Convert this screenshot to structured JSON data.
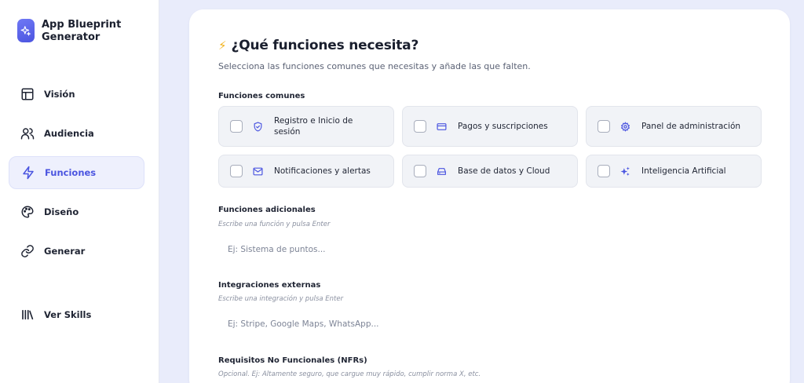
{
  "brand": {
    "title": "App Blueprint Generator"
  },
  "sidebar": {
    "items": [
      {
        "label": "Visión",
        "icon": "layout-icon"
      },
      {
        "label": "Audiencia",
        "icon": "users-icon"
      },
      {
        "label": "Funciones",
        "icon": "bolt-icon",
        "active": true
      },
      {
        "label": "Diseño",
        "icon": "palette-icon"
      },
      {
        "label": "Generar",
        "icon": "link-icon"
      },
      {
        "label": "Ver Skills",
        "icon": "library-icon"
      }
    ]
  },
  "main": {
    "title": "¿Qué funciones necesita?",
    "title_icon": "⚡",
    "subtitle": "Selecciona las funciones comunes que necesitas y añade las que falten.",
    "common": {
      "label": "Funciones comunes",
      "items": [
        {
          "label": "Registro e Inicio de sesión",
          "icon": "shield-icon",
          "checked": false
        },
        {
          "label": "Pagos y suscripciones",
          "icon": "credit-card-icon",
          "checked": false
        },
        {
          "label": "Panel de administración",
          "icon": "gear-icon",
          "checked": false
        },
        {
          "label": "Notificaciones y alertas",
          "icon": "mail-icon",
          "checked": false
        },
        {
          "label": "Base de datos y Cloud",
          "icon": "database-icon",
          "checked": false
        },
        {
          "label": "Inteligencia Artificial",
          "icon": "sparkles-icon",
          "checked": false
        }
      ]
    },
    "additional": {
      "label": "Funciones adicionales",
      "hint": "Escribe una función y pulsa Enter",
      "placeholder": "Ej: Sistema de puntos...",
      "value": ""
    },
    "integrations": {
      "label": "Integraciones externas",
      "hint": "Escribe una integración y pulsa Enter",
      "placeholder": "Ej: Stripe, Google Maps, WhatsApp...",
      "value": ""
    },
    "nfr": {
      "label": "Requisitos No Funcionales (NFRs)",
      "hint": "Opcional. Ej: Altamente seguro, que cargue muy rápido, cumplir norma X, etc."
    }
  },
  "colors": {
    "accent": "#4b55e0",
    "accent_bg": "#eef0fd",
    "page_bg": "#e9ecfb"
  }
}
